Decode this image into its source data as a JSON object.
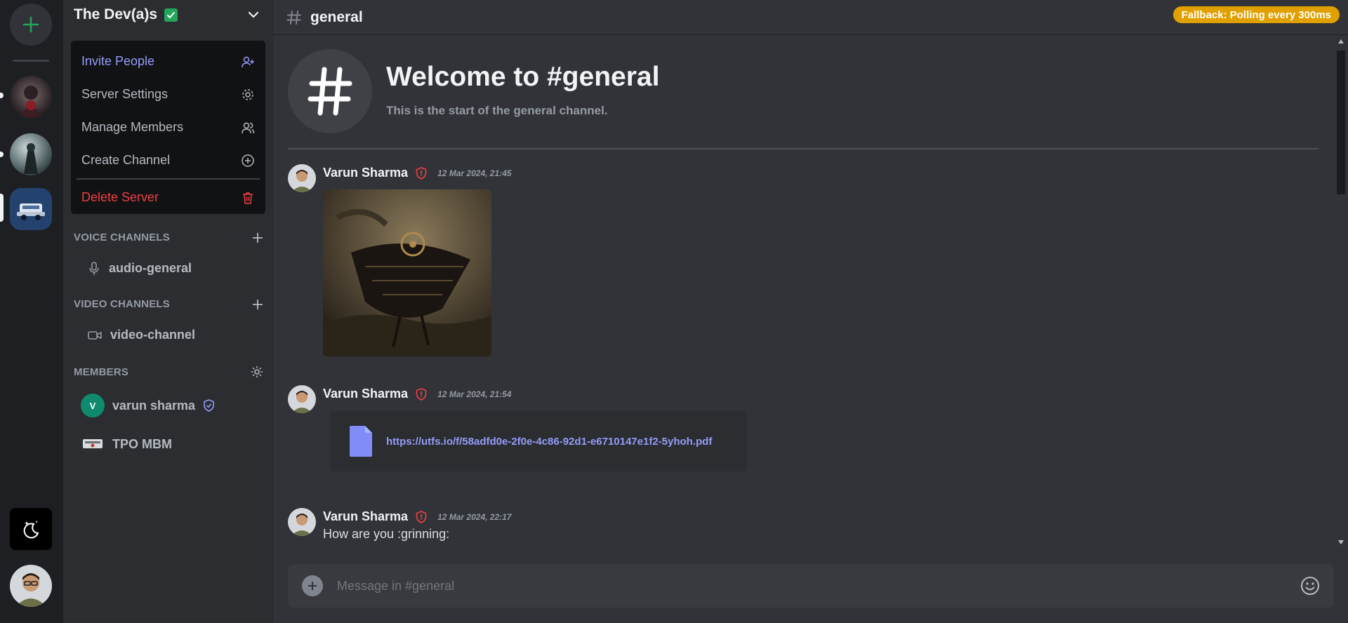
{
  "server": {
    "name": "The Dev(a)s",
    "menu": {
      "invite": "Invite People",
      "settings": "Server Settings",
      "members": "Manage Members",
      "create_channel": "Create Channel",
      "delete": "Delete Server"
    },
    "sections": {
      "voice": "VOICE CHANNELS",
      "video": "VIDEO CHANNELS",
      "members": "MEMBERS"
    },
    "voice_channels": [
      "audio-general"
    ],
    "video_channels": [
      "video-channel"
    ],
    "members": [
      {
        "name": "varun sharma",
        "initial": "V"
      },
      {
        "name": "TPO MBM"
      }
    ]
  },
  "channel": {
    "name": "general",
    "fallback_badge": "Fallback: Polling every 300ms",
    "welcome_title": "Welcome to #general",
    "welcome_sub": "This is the start of the general channel."
  },
  "messages": [
    {
      "author": "Varun Sharma",
      "time": "12 Mar 2024, 21:45",
      "type": "image"
    },
    {
      "author": "Varun Sharma",
      "time": "12 Mar 2024, 21:54",
      "type": "file",
      "link": "https://utfs.io/f/58adfd0e-2f0e-4c86-92d1-e6710147e1f2-5yhoh.pdf"
    },
    {
      "author": "Varun Sharma",
      "time": "12 Mar 2024, 22:17",
      "type": "text",
      "text": "How are you :grinning:"
    }
  ],
  "composer": {
    "placeholder": "Message in #general"
  },
  "colors": {
    "accent": "#949cf7",
    "danger": "#f23f43",
    "success": "#23a55a",
    "warning": "#e0a000"
  }
}
